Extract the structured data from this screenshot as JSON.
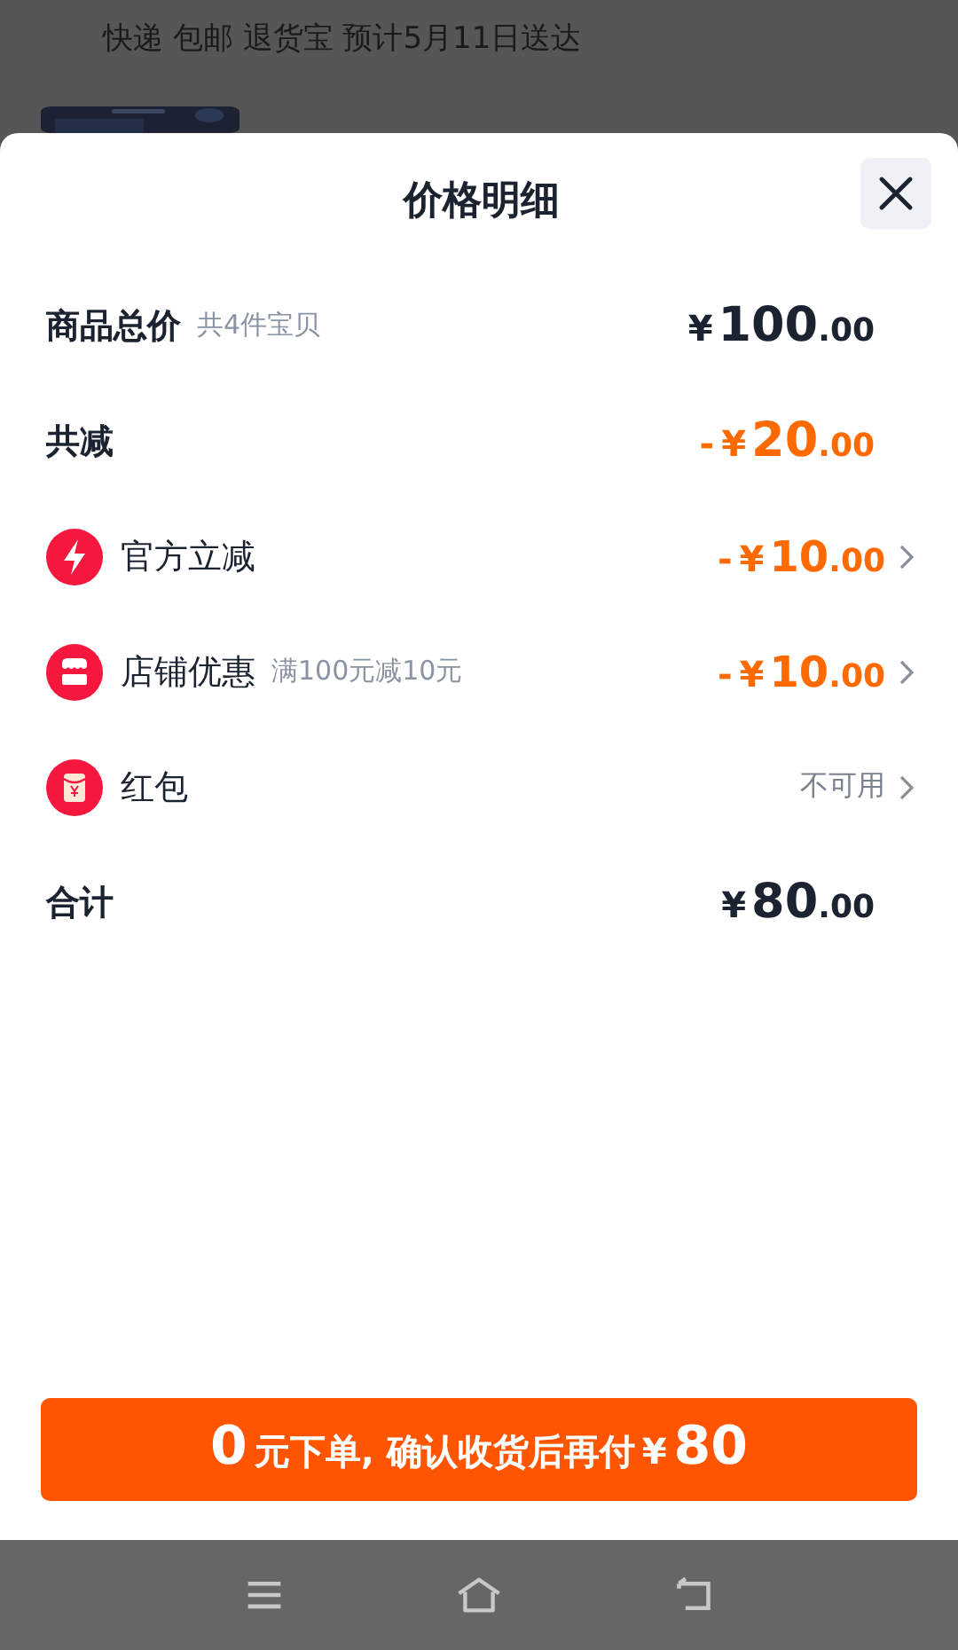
{
  "background": {
    "delivery_line": "快递 包邮 退货宝 预计5月11日送达"
  },
  "sheet": {
    "title": "价格明细",
    "rows": [
      {
        "kind": "summary",
        "label": "商品总价",
        "note": "共4件宝贝",
        "price": {
          "currency": "¥",
          "integer": "100",
          "decimals": ".00",
          "highlight": false
        },
        "chevron": false
      },
      {
        "kind": "summary",
        "label": "共减",
        "price": {
          "sign": "-",
          "currency": "¥",
          "integer": "20",
          "decimals": ".00",
          "highlight": true
        },
        "chevron": false
      },
      {
        "kind": "instant",
        "label": "官方立减",
        "price": {
          "sign": "-",
          "currency": "¥",
          "integer": "10",
          "decimals": ".00",
          "highlight": true
        },
        "chevron": true
      },
      {
        "kind": "shop",
        "label": "店铺优惠",
        "note": "满100元减10元",
        "price": {
          "sign": "-",
          "currency": "¥",
          "integer": "10",
          "decimals": ".00",
          "highlight": true
        },
        "chevron": true
      },
      {
        "kind": "packet",
        "label": "红包",
        "status": "不可用",
        "chevron": true
      },
      {
        "kind": "summary",
        "label": "合计",
        "price": {
          "currency": "¥",
          "integer": "80",
          "decimals": ".00",
          "highlight": false
        },
        "chevron": false
      }
    ],
    "button": [
      {
        "text": "0",
        "big": true
      },
      {
        "text": "元下单, 确认收货后再付",
        "big": false
      },
      {
        "text": "¥",
        "big": false
      },
      {
        "text": "80",
        "big": true
      }
    ]
  }
}
